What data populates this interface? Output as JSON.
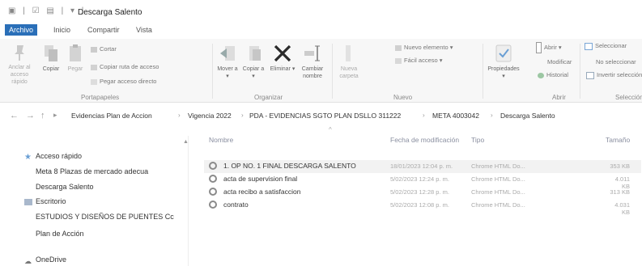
{
  "window": {
    "quick_access": "▣ | ☑ ▤ | ▾ |",
    "title": "Descarga Salento"
  },
  "ribbon_tabs": [
    "Archivo",
    "Inicio",
    "Compartir",
    "Vista"
  ],
  "ribbon": {
    "pin_label": "Anclar al acceso rápido",
    "copy_label": "Copiar",
    "paste_label": "Pegar",
    "cut_label": "Cortar",
    "copy_path_label": "Copiar ruta de acceso",
    "paste_shortcut_label": "Pegar acceso directo",
    "clipboard_group": "Portapapeles",
    "move_label": "Mover a ▾",
    "copyto_label": "Copiar a ▾",
    "delete_label": "Eliminar ▾",
    "rename_label": "Cambiar nombre",
    "organize_group": "Organizar",
    "new_folder_label": "Nueva carpeta",
    "new_item_label": "Nuevo elemento ▾",
    "easy_access_label": "Fácil acceso ▾",
    "new_group": "Nuevo",
    "properties_label": "Propiedades ▾",
    "open_label": "Abrir ▾",
    "edit_label": "Modificar",
    "history_label": "Historial",
    "open_group": "Abrir",
    "select_all_label": "Seleccionar",
    "select_none_label": "No seleccionar",
    "invert_label": "Invertir selección",
    "select_group": "Selección"
  },
  "address": {
    "back": "←",
    "forward": "→",
    "up": "↑",
    "crumbs": [
      "Evidencias Plan de Accion",
      "Vigencia 2022",
      "PDA - EVIDENCIAS SGTO PLAN DSLLO 311222",
      "META 4003042",
      "Descarga Salento"
    ],
    "separator": "›"
  },
  "nav_pane": {
    "quick_access": "Acceso rápido",
    "items": [
      "Meta 8 Plazas de mercado adecua",
      "Descarga Salento",
      "Escritorio",
      "ESTUDIOS Y DISEÑOS DE PUENTES Cc",
      "Plan de Acción"
    ],
    "onedrive": "OneDrive"
  },
  "file_list": {
    "columns": [
      "Nombre",
      "Fecha de modificación",
      "Tipo",
      "Tamaño"
    ],
    "rows": [
      {
        "name": "1. OP NO. 1 FINAL DESCARGA SALENTO",
        "date": "18/01/2023 12:04 p. m.",
        "type": "Chrome HTML Do...",
        "size": "353 KB"
      },
      {
        "name": "acta de supervision final",
        "date": "5/02/2023 12:24 p. m.",
        "type": "Chrome HTML Do...",
        "size": "4.011 KB"
      },
      {
        "name": "acta recibo a satisfaccion",
        "date": "5/02/2023 12:28 p. m.",
        "type": "Chrome HTML Do...",
        "size": "313 KB"
      },
      {
        "name": "contrato",
        "date": "5/02/2023 12:08 p. m.",
        "type": "Chrome HTML Do...",
        "size": "4.031 KB"
      }
    ]
  },
  "colors": {
    "accent": "#2a6fb8",
    "delete_x": "#2b2b2b",
    "chrome_icon": "#8a8a8a"
  }
}
